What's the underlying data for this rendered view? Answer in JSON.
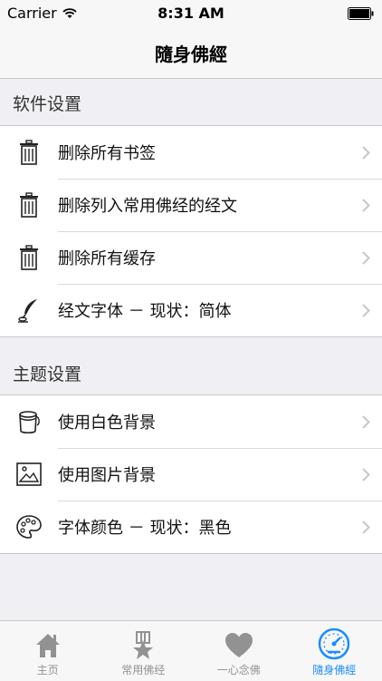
{
  "status_bar": {
    "carrier": "Carrier",
    "time": "8:31 AM"
  },
  "nav": {
    "title": "隨身佛經"
  },
  "sections": [
    {
      "header": "软件设置",
      "rows": [
        {
          "label": "删除所有书签",
          "icon": "trash-icon"
        },
        {
          "label": "删除列入常用佛经的经文",
          "icon": "trash-icon"
        },
        {
          "label": "删除所有缓存",
          "icon": "trash-icon"
        },
        {
          "label": "经文字体 － 现状：简体",
          "icon": "quill-pen-icon"
        }
      ]
    },
    {
      "header": "主题设置",
      "rows": [
        {
          "label": "使用白色背景",
          "icon": "paint-bucket-icon"
        },
        {
          "label": "使用图片背景",
          "icon": "picture-icon"
        },
        {
          "label": "字体颜色 － 现状：黑色",
          "icon": "palette-icon"
        }
      ]
    }
  ],
  "tabs": [
    {
      "label": "主页",
      "icon": "home-icon"
    },
    {
      "label": "常用佛经",
      "icon": "star-badge-icon"
    },
    {
      "label": "一心念佛",
      "icon": "heart-icon"
    },
    {
      "label": "隨身佛經",
      "icon": "dashboard-icon",
      "active": true
    }
  ],
  "colors": {
    "accent": "#1a8cff",
    "tab_inactive": "#929292",
    "background": "#efeff4"
  }
}
